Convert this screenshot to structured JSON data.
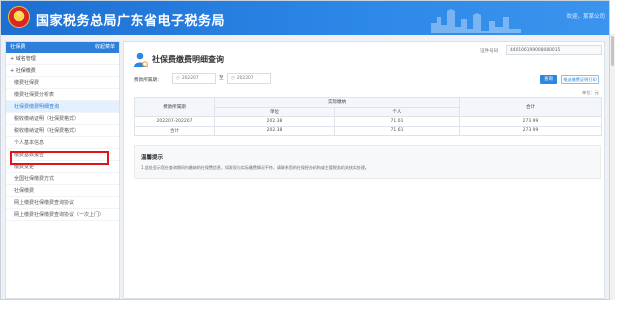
{
  "header": {
    "title": "国家税务总局广东省电子税务局",
    "user_text": "欢迎，某某公司"
  },
  "sidebar": {
    "title": "社保费",
    "collapse_label": "收起菜单",
    "items": [
      {
        "label": "+ 域名管理",
        "type": "group"
      },
      {
        "label": "+ 社保缴费",
        "type": "group"
      },
      {
        "label": "缴费社保费",
        "type": "item"
      },
      {
        "label": "缴费社保费分析表",
        "type": "item"
      },
      {
        "label": "社保费缴费明细查询",
        "type": "active"
      },
      {
        "label": "税收缴纳证明（社保费格式）",
        "type": "item"
      },
      {
        "label": "税收缴纳证明（社保费格式）",
        "type": "item"
      },
      {
        "label": "个人基本信息",
        "type": "item"
      },
      {
        "label": "缴费基数报告",
        "type": "item"
      },
      {
        "label": "缴费变更",
        "type": "item"
      },
      {
        "label": "全国社保缴费方式",
        "type": "item"
      },
      {
        "label": "社保缴费",
        "type": "item"
      },
      {
        "label": "网上缴费社保缴费查询协议",
        "type": "item"
      },
      {
        "label": "网上缴费社保缴费查询协议（一次上门）",
        "type": "item"
      }
    ]
  },
  "main": {
    "title": "社保费缴费明细查询",
    "ident_label": "证件号码",
    "ident_value": "440106199008080015",
    "period_label": "费款所属期：",
    "date_from": "202207",
    "date_to": "202207",
    "date_sep": "至",
    "query_button": "查询",
    "print_button": "推送缴费证明打印",
    "unit_label": "单位：元",
    "table": {
      "head_period": "费款所属期",
      "head_group": "实际缴纳",
      "head_unit": "单位",
      "head_person": "个人",
      "head_total": "合计",
      "rows": [
        {
          "period": "202207-202207",
          "unit": "202.38",
          "person": "71.61",
          "total": "273.99"
        },
        {
          "period": "合计",
          "unit": "202.38",
          "person": "71.61",
          "total": "273.99"
        }
      ]
    },
    "notice": {
      "title": "温馨提示",
      "text": "1.此处显示您在查询期间内缴纳的社保费信息，如发现与实际缴费情况不符，请联系您的社保经办机构或主管税务机关核实处理。"
    },
    "icon_color": "#2e86e0"
  }
}
